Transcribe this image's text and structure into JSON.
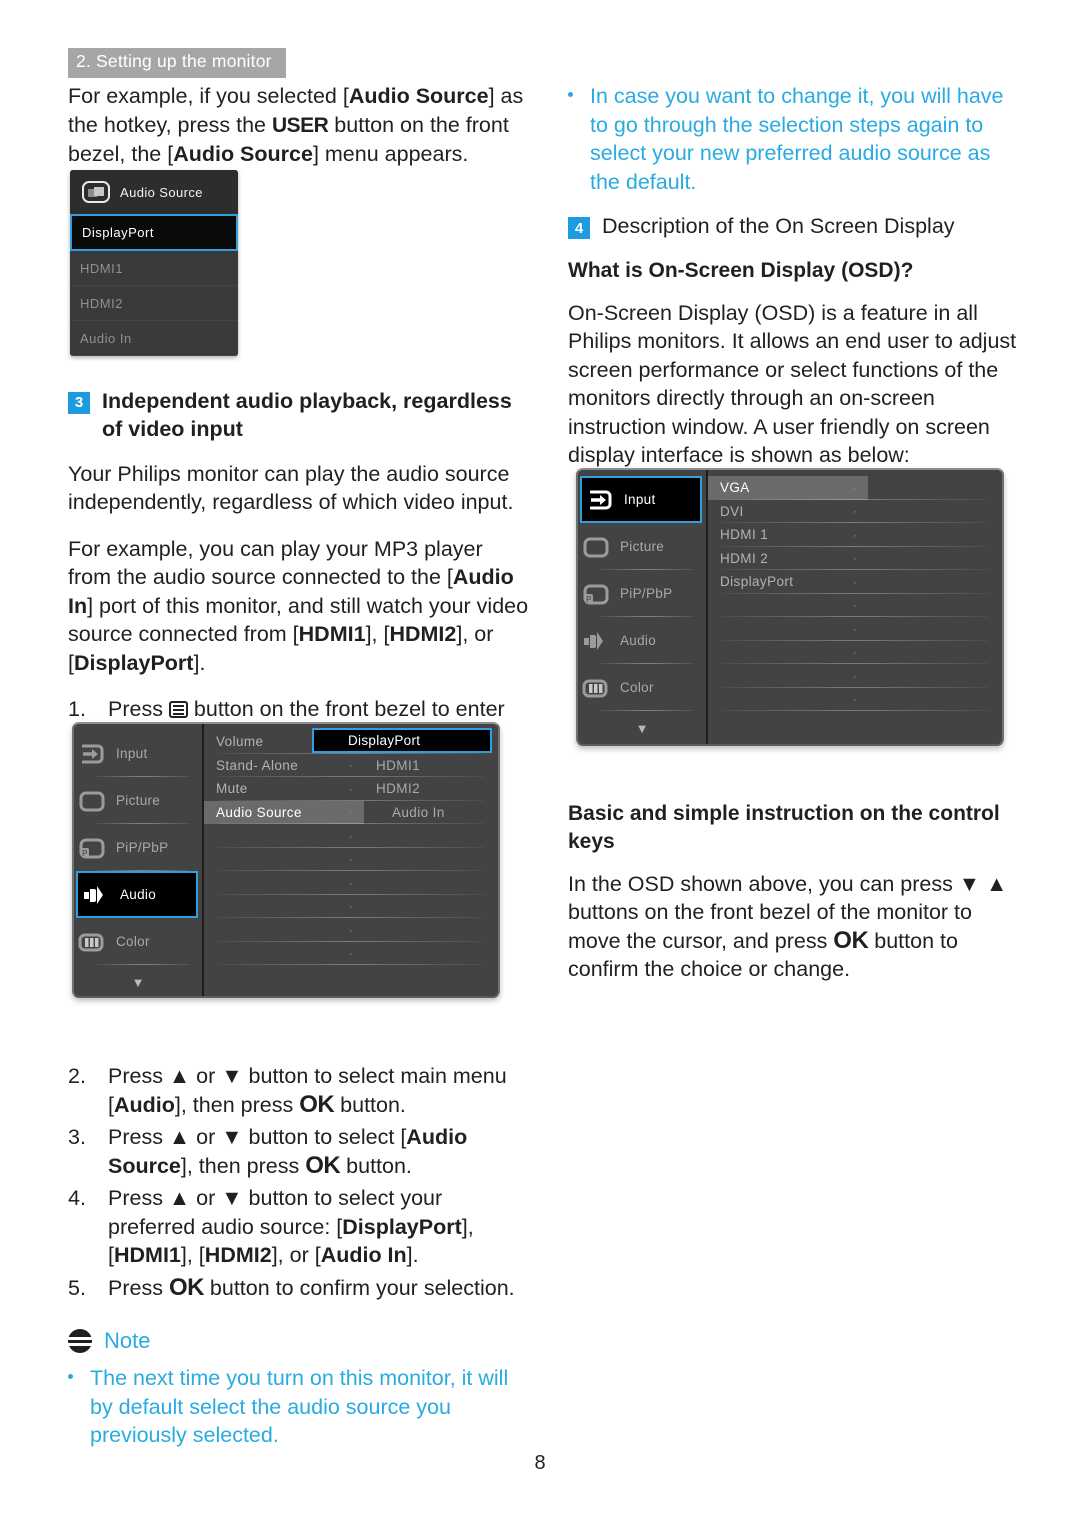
{
  "header": {
    "chapter_tab": "2. Setting up the monitor"
  },
  "page_number": "8",
  "left_column": {
    "intro_paragraph": {
      "seg1": "For example, if you selected [",
      "bold1": "Audio Source",
      "seg2": "] as the hotkey, press the ",
      "key": "USER",
      "seg3": " button on the front bezel, the [",
      "bold2": "Audio Source",
      "seg4": "] menu appears."
    },
    "popup_osd": {
      "title": "Audio Source",
      "icon": "picture-source-icon",
      "items": [
        {
          "label": "DisplayPort",
          "selected": true
        },
        {
          "label": "HDMI1",
          "selected": false
        },
        {
          "label": "HDMI2",
          "selected": false
        },
        {
          "label": "Audio In",
          "selected": false
        }
      ]
    },
    "section3": {
      "number": "3",
      "heading": "Independent audio playback, regardless of video input",
      "para1": "Your Philips monitor can play the audio source independently, regardless of which video input.",
      "para2": {
        "seg1": "For example, you can play your MP3 player from the audio source connected to the [",
        "bold1": "Audio In",
        "seg2": "] port of this monitor, and still watch your video source connected from [",
        "bold2": "HDMI1",
        "seg3": "], [",
        "bold3": "HDMI2",
        "seg4": "], or [",
        "bold4": "DisplayPort",
        "seg5": "]."
      }
    },
    "steps": [
      {
        "number": "1.",
        "seg1": "Press ",
        "icon": "menu-bars-icon",
        "seg2": " button on the front bezel to enter OSD Menu Screen."
      },
      {
        "number": "2.",
        "seg1": "Press ▲ or ▼ button to select main menu [",
        "bold1": "Audio",
        "seg2": "], then press ",
        "key": "OK",
        "seg3": " button."
      },
      {
        "number": "3.",
        "seg1": "Press ▲ or ▼ button to select [",
        "bold1": "Audio Source",
        "seg2": "], then press ",
        "key": "OK",
        "seg3": " button."
      },
      {
        "number": "4.",
        "seg1": "Press ▲ or ▼ button to select your preferred audio source: [",
        "bold1": "DisplayPort",
        "seg2": "], [",
        "bold2": "HDMI1",
        "seg3": "], [",
        "bold3": "HDMI2",
        "seg4": "], or [",
        "bold4": "Audio In",
        "seg5": "]."
      },
      {
        "number": "5.",
        "seg1": "Press ",
        "key": "OK",
        "seg2": " button to confirm your selection."
      }
    ],
    "osd_audio": {
      "sidebar": [
        {
          "label": "Input",
          "icon": "input-arrow-icon",
          "selected": false
        },
        {
          "label": "Picture",
          "icon": "picture-frame-icon",
          "selected": false
        },
        {
          "label": "PiP/PbP",
          "icon": "pip-pbp-icon",
          "selected": false
        },
        {
          "label": "Audio",
          "icon": "speaker-icon",
          "selected": true
        },
        {
          "label": "Color",
          "icon": "color-bars-icon",
          "selected": false
        }
      ],
      "scroll_arrow": "▼",
      "menu_items": [
        {
          "label": "Volume",
          "highlighted": false
        },
        {
          "label": "Stand- Alone",
          "highlighted": false
        },
        {
          "label": "Mute",
          "highlighted": false
        },
        {
          "label": "Audio Source",
          "highlighted": true
        }
      ],
      "values": [
        {
          "label": "DisplayPort",
          "selected": true
        },
        {
          "label": "HDMI1",
          "selected": false
        },
        {
          "label": "HDMI2",
          "selected": false
        },
        {
          "label": "Audio In",
          "selected": false
        }
      ]
    },
    "note": {
      "title": "Note",
      "bullets": [
        "The next time you turn on this monitor, it will by default select the audio source you previously selected."
      ]
    }
  },
  "right_column": {
    "note_bullets": [
      "In case you want to change it, you will have to go through the selection steps again to select your new preferred audio source as the default."
    ],
    "section4": {
      "number": "4",
      "heading": "Description of the On Screen Display",
      "sub_heading": "What is On-Screen Display (OSD)?",
      "para": "On-Screen Display (OSD) is a feature in all Philips monitors. It allows an end user to adjust screen performance or select functions of the monitors directly through an on-screen instruction window. A user friendly on screen display interface is shown as below:"
    },
    "osd_input": {
      "sidebar": [
        {
          "label": "Input",
          "icon": "input-arrow-icon",
          "selected": true
        },
        {
          "label": "Picture",
          "icon": "picture-frame-icon",
          "selected": false
        },
        {
          "label": "PiP/PbP",
          "icon": "pip-pbp-icon",
          "selected": false
        },
        {
          "label": "Audio",
          "icon": "speaker-icon",
          "selected": false
        },
        {
          "label": "Color",
          "icon": "color-bars-icon",
          "selected": false
        }
      ],
      "scroll_arrow": "▼",
      "menu_items": [
        {
          "label": "VGA",
          "highlighted": true
        },
        {
          "label": "DVI",
          "highlighted": false
        },
        {
          "label": "HDMI 1",
          "highlighted": false
        },
        {
          "label": "HDMI 2",
          "highlighted": false
        },
        {
          "label": "DisplayPort",
          "highlighted": false
        }
      ]
    },
    "control_keys": {
      "heading": "Basic and simple instruction on the control keys",
      "para": {
        "seg1": "In the OSD shown above, you can press ▼ ▲ buttons on the front bezel of the monitor to move the cursor, and press ",
        "key": "OK",
        "seg2": " button to confirm the choice or change."
      }
    }
  },
  "colors": {
    "accent_blue": "#29abe2",
    "number_box_blue": "#1e9ae0",
    "osd_select_blue": "#2f9fe0",
    "chapter_tab_grey": "#a6a6a6",
    "text_black": "#231f20"
  }
}
